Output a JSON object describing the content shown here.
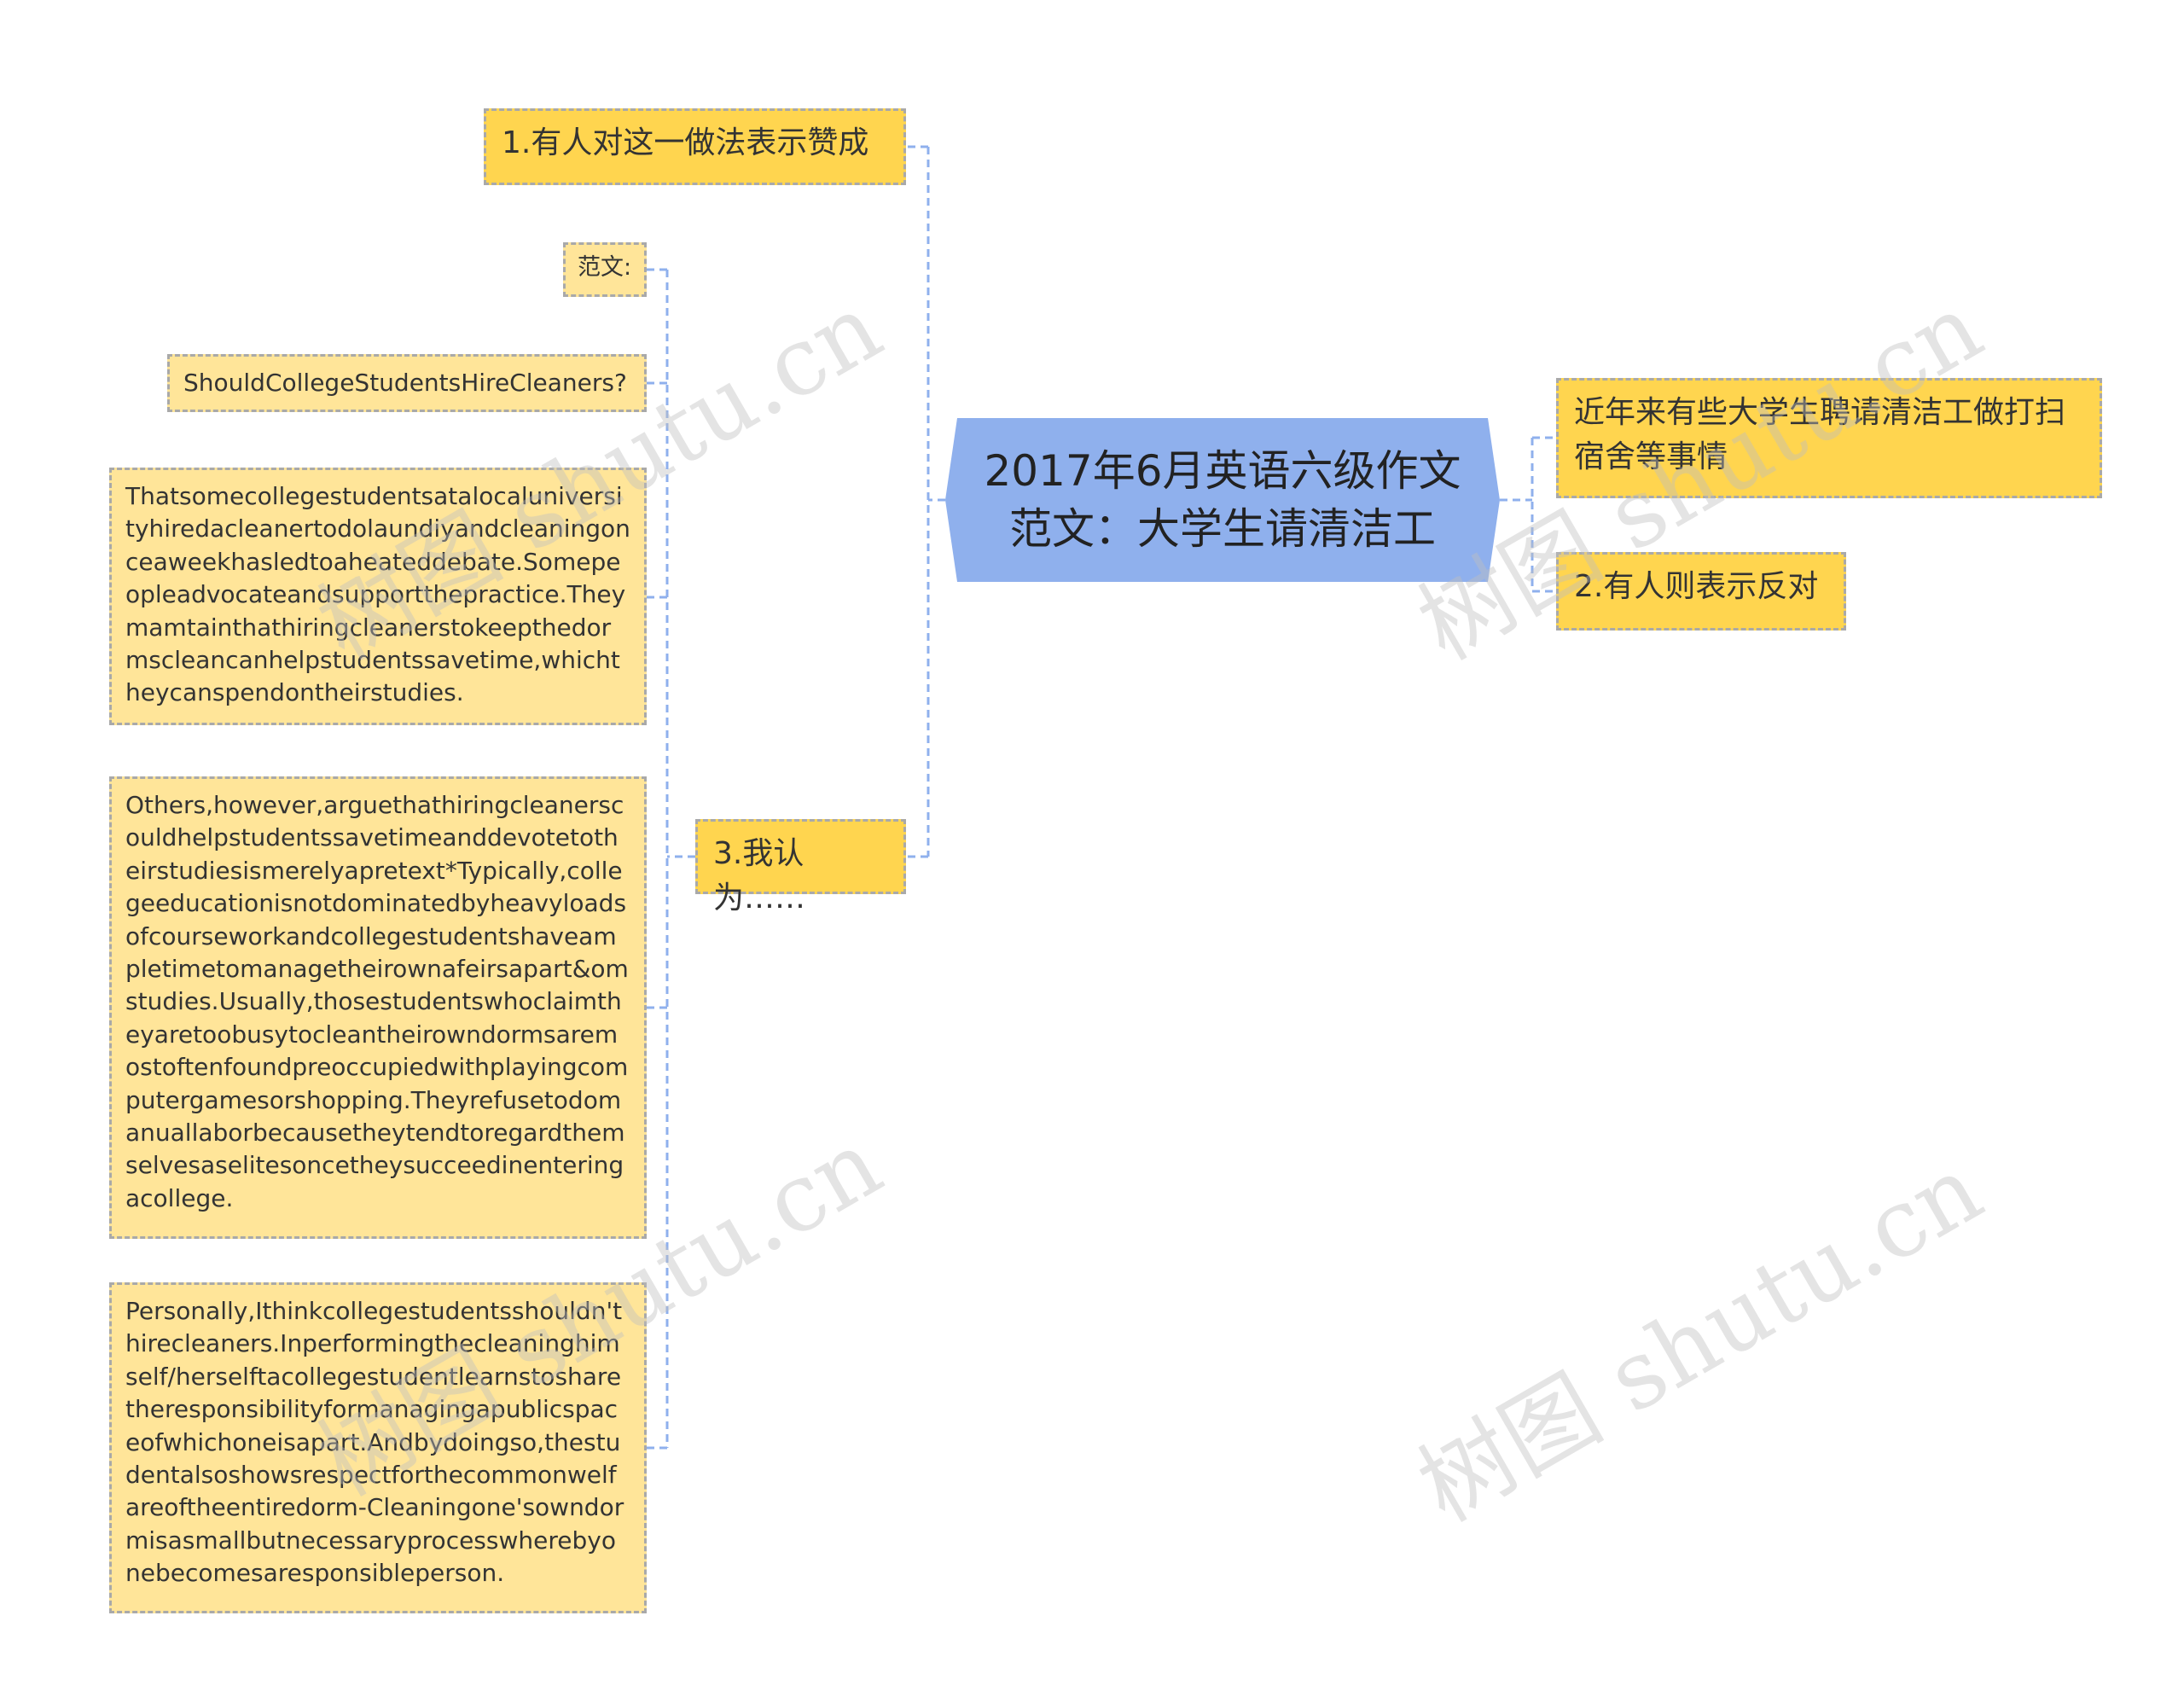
{
  "root": {
    "line1": "2017年6月英语六级作文",
    "line2": "范文：大学生请清洁工"
  },
  "right": [
    "近年来有些大学生聘请清洁工做打扫宿舍等事情",
    "2.有人则表示反对"
  ],
  "left": {
    "point1": "1.有人对这一做法表示赞成",
    "point3": "3.我认为……",
    "children": [
      "范文:",
      "ShouldCollegeStudentsHireCleaners?",
      "Thatsomecollegestudentsatalocaluniversityhiredacleanertodolaundiyandcleaningonceaweekhasledtoaheateddebate.Somepeopleadvocateandsupportthepractice.Theymamtainthathiringcleanerstokeepthedormscleancanhelpstudentssavetime,whichtheycanspendontheirstudies.",
      "Others,however,arguethathiringcleanerscouldhelpstudentssavetimeanddevotetotheirstudiesismerelyapretext*Typically,collegeeducationisnotdominatedbyheavyloadsofcourseworkandcollegestudentshaveampletimetomanagetheirownafeirsapart&omstudies.Usually,thosestudentswhoclaimtheyaretoobusytocleantheirowndormsaremostoftenfoundpreoccupiedwithplayingcomputergamesorshopping.Theyrefusetodomanuallaborbecausetheytendtoregardthemselvesaselitesoncetheysucceedinenteringacollege.",
      "Personally,Ithinkcollegestudentsshouldn'thirecleaners.Inperformingthecleaninghimself/herselftacollegestudentlearnstosharetheresponsibilityformanagingapublicspaceofwhichoneisapart.Andbydoingso,thestudentalsoshowsrespectforthecommonwelfareoftheentiredorm-Cleaningone'sowndormisasmallbutnecessaryprocesswherebyonebecomesaresponsibleperson."
    ]
  },
  "watermark": "树图 shutu.cn",
  "colors": {
    "root_fill": "#8fb0ed",
    "level1_fill": "#ffd54f",
    "level2_fill": "#ffe599",
    "connector": "#8fb0ed",
    "node_border": "#a9a9a9"
  }
}
